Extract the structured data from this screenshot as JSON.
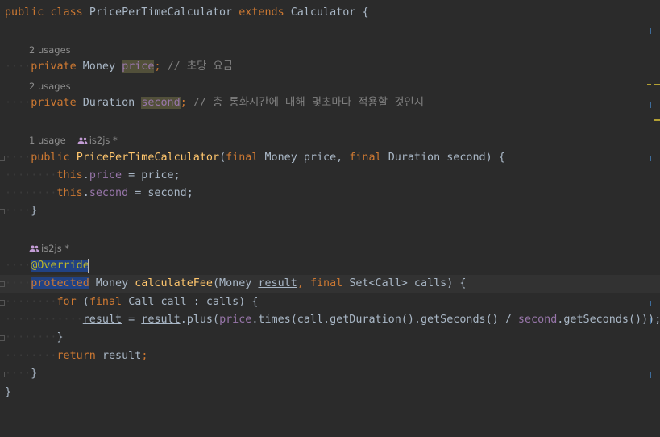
{
  "hints": {
    "price_usages": "2 usages",
    "second_usages": "2 usages",
    "ctor_usage": "1 usage",
    "ctor_author": "is2js *",
    "override_author": "is2js *"
  },
  "code": {
    "l1": {
      "kw_public": "public",
      "kw_class": "class",
      "class_name": "PricePerTimeCalculator",
      "kw_extends": "extends",
      "super_name": "Calculator",
      "brace": "{"
    },
    "l_price": {
      "kw": "private",
      "type": "Money",
      "name": "price",
      "semi": ";",
      "comment": "// 초당 요금"
    },
    "l_second": {
      "kw": "private",
      "type": "Duration",
      "name": "second",
      "semi": ";",
      "comment": "// 총 통화시간에 대해 몇초마다 적용할 것인지"
    },
    "l_ctor": {
      "kw": "public",
      "name": "PricePerTimeCalculator",
      "open": "(",
      "final1": "final",
      "p1": "Money price,",
      "final2": "final",
      "p2": "Duration second) {"
    },
    "l_this_price": {
      "kw": "this",
      "rest_a": ".",
      "field": "price",
      "rest_b": " = price;"
    },
    "l_this_second": {
      "kw": "this",
      "rest_a": ".",
      "field": "second",
      "rest_b": " = second;"
    },
    "close_brace": "}",
    "l_override": {
      "at": "@",
      "name": "Override"
    },
    "l_method": {
      "kw": "protected",
      "type": "Money",
      "name": "calculateFee",
      "p_open": "(Money ",
      "p_result": "result",
      "comma": ",",
      "final": "final",
      "p_rest": "Set<Call> calls) {"
    },
    "l_for": {
      "kw": "for",
      "open": "(",
      "final": "final",
      "rest": "Call call : calls) {"
    },
    "l_assign": {
      "lhs": "result",
      "eq": " = ",
      "rhs": "result",
      "call_a": ".plus(",
      "field_price": "price",
      "call_b": ".times(call.getDuration().getSeconds() / ",
      "field_second": "second",
      "call_c": ".getSeconds()));"
    },
    "l_return": {
      "kw": "return",
      "val": "result",
      "semi": ";"
    }
  }
}
